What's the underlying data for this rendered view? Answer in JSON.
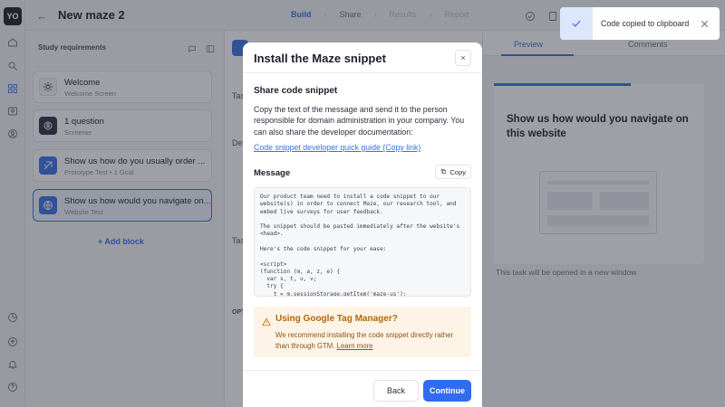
{
  "user": {
    "initials": "YO"
  },
  "header": {
    "back_icon": "arrow-left-icon",
    "title": "New maze 2",
    "steps": [
      {
        "label": "Build",
        "state": "active"
      },
      {
        "label": "Share",
        "state": "done"
      },
      {
        "label": "Results",
        "state": "disabled"
      },
      {
        "label": "Report",
        "state": "disabled"
      }
    ]
  },
  "sidebar": {
    "heading": "Study requirements",
    "blocks": [
      {
        "title": "Welcome",
        "subtitle": "Welcome Screen",
        "icon": "sun-icon"
      },
      {
        "title": "1 question",
        "subtitle": "Screener",
        "icon": "user-filter-icon"
      },
      {
        "title": "Show us how do you usually order ...",
        "subtitle": "Prototype Test • 1 Goal",
        "icon": "prototype-icon"
      },
      {
        "title": "Show us how would you navigate on...",
        "subtitle": "Website Test",
        "icon": "globe-icon"
      }
    ],
    "add_block_label": "+ Add block"
  },
  "main": {
    "labels": [
      "Task",
      "Desc",
      "Tas",
      "OPT"
    ]
  },
  "preview": {
    "tab_preview": "Preview",
    "tab_comments": "Comments",
    "progress": 0.65,
    "question": "Show us how would you navigate on this website",
    "note": "This task will be opened in a new window"
  },
  "modal": {
    "title": "Install the Maze snippet",
    "close_label": "×",
    "section_title": "Share code snippet",
    "description": "Copy the text of the message and send it to the person responsible for domain administration in your company. You can also share the developer documentation:",
    "doc_link": "Code snippet developer quick guide (Copy link)",
    "message_label": "Message",
    "copy_label": "Copy",
    "code": "Our product team need to install a code snippet to our website(s) in order to connect Maze, our research tool, and embed live surveys for user feedback.\n\nThe snippet should be pasted immediately after the website's <head>.\n\nHere's the code snippet for your ease:\n\n<script>\n(function (m, a, z, e) {\n  var s, t, u, v;\n  try {\n    t = m.sessionStorage.getItem('maze-us');\n  } catch (err) {}",
    "warning": {
      "title": "Using Google Tag Manager?",
      "body": "We recommend installing the code snippet directly rather than through GTM.",
      "link": "Learn more"
    },
    "back_label": "Back",
    "continue_label": "Continue"
  },
  "toast": {
    "message": "Code copied to clipboard"
  },
  "colors": {
    "accent": "#3a6fe8",
    "primary_button": "#2f6cf0",
    "warning_bg": "#fdf3e6",
    "warning_text": "#b06a0c"
  }
}
